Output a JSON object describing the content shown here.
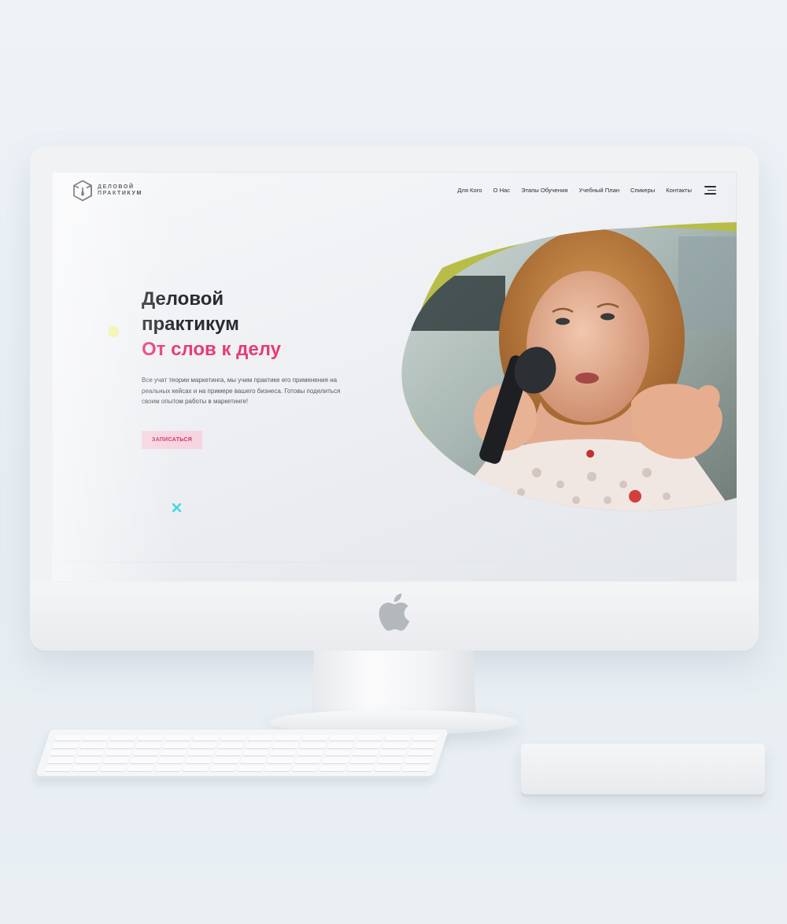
{
  "brand": {
    "line1": "ДЕЛОВОЙ",
    "line2": "ПРАКТИКУМ"
  },
  "nav": {
    "items": [
      {
        "label": "Для Кого"
      },
      {
        "label": "О Нас"
      },
      {
        "label": "Этапы Обучения"
      },
      {
        "label": "Учебный План"
      },
      {
        "label": "Спикеры"
      },
      {
        "label": "Контакты"
      }
    ],
    "menu_icon": "hamburger-icon"
  },
  "hero": {
    "title_line1": "Деловой",
    "title_line2": "практикум",
    "tagline": "От слов к делу",
    "description": "Все учат теории маркетинга, мы учим практике его применения на реальных кейсах и на примере вашего бизнеса. Готовы поделиться своим опытом работы в маркетинге!",
    "cta_label": "ЗАПИСАТЬСЯ"
  },
  "colors": {
    "accent": "#e63c74",
    "cta_bg": "#f6d5e0",
    "blob_green": "#b7bd47",
    "dot_yellow": "#eef29a",
    "cross_cyan": "#39d9e6",
    "text_dark": "#2a2b30"
  }
}
